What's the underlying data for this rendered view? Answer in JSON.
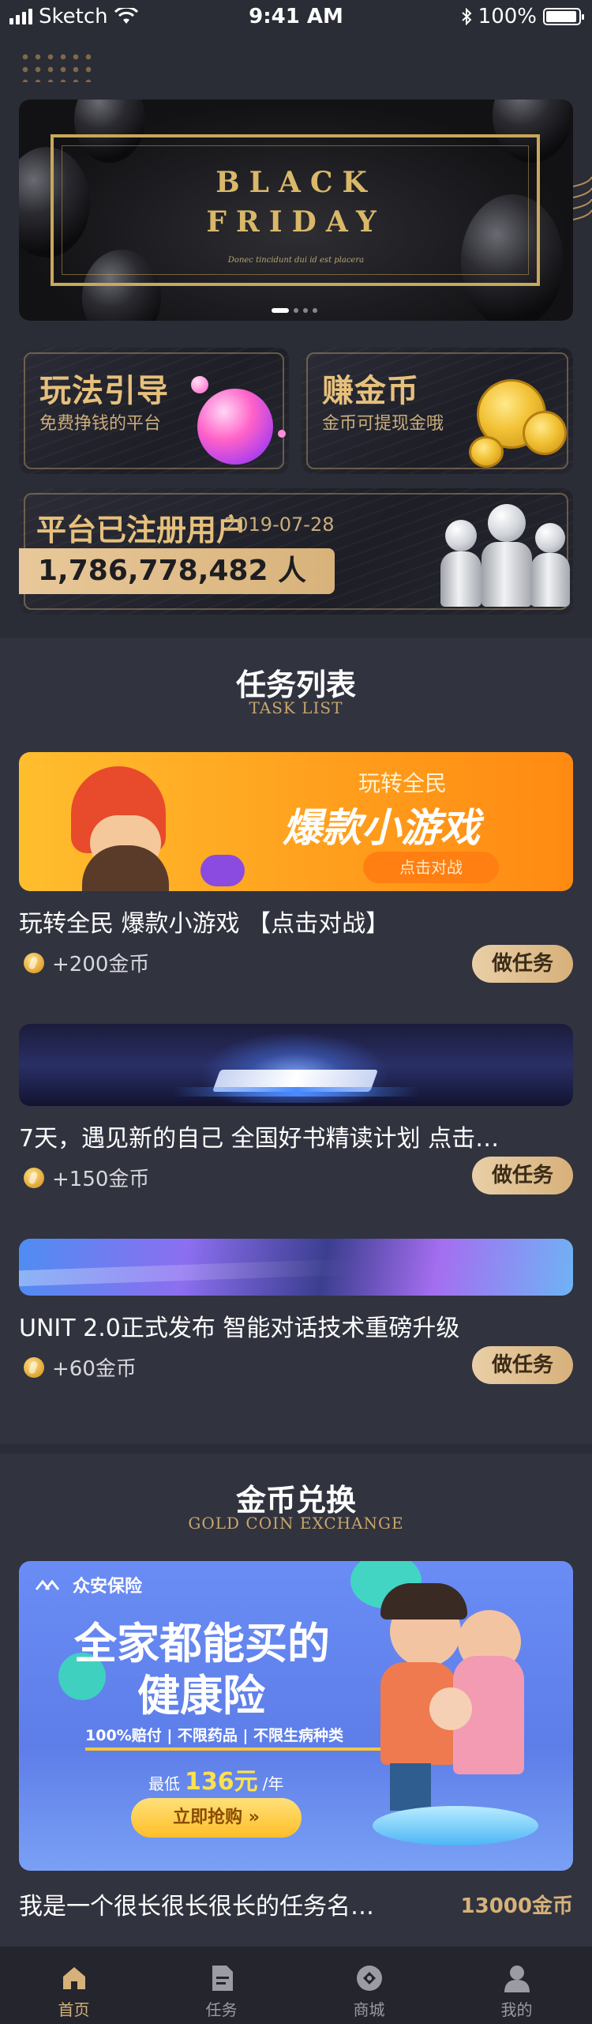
{
  "status_bar": {
    "carrier": "Sketch",
    "time": "9:41 AM",
    "battery": "100%"
  },
  "banner": {
    "line1": "BLACK",
    "line2": "FRIDAY",
    "tagline": "Donec tincidunt dui id est placera",
    "slide_count": 4,
    "active_slide": 1
  },
  "promo_cards": {
    "guide": {
      "title": "玩法引导",
      "desc": "免费挣钱的平台"
    },
    "earn": {
      "title": "赚金币",
      "desc": "金币可提现金哦"
    }
  },
  "registered": {
    "title": "平台已注册用户",
    "date": "2019-07-28",
    "count": "1,786,778,482 人"
  },
  "task_section": {
    "title": "任务列表",
    "subtitle": "TASK LIST"
  },
  "tasks": [
    {
      "banner_text": "玩转全民",
      "banner_big": "爆款小游戏",
      "banner_btn": "点击对战",
      "name": "玩转全民 爆款小游戏 【点击对战】",
      "reward": "+200金币",
      "button": "做任务"
    },
    {
      "name": "7天，遇见新的自己 全国好书精读计划 点击…",
      "reward": "+150金币",
      "button": "做任务"
    },
    {
      "name": "UNIT 2.0正式发布 智能对话技术重磅升级",
      "reward": "+60金币",
      "button": "做任务"
    }
  ],
  "exchange_section": {
    "title": "金币兑换",
    "subtitle": "GOLD COIN EXCHANGE"
  },
  "exchange_item": {
    "brand": "众安保险",
    "headline1": "全家都能买的",
    "headline2": "健康险",
    "features": "100%赔付 | 不限药品 | 不限生病种类",
    "price_prefix": "最低",
    "price": "136元",
    "price_suffix": "/年",
    "cta": "立即抢购 »",
    "name": "我是一个很长很长很长的任务名…",
    "cost": "13000金币"
  },
  "nav": {
    "items": [
      {
        "label": "首页",
        "icon": "home-icon",
        "active": true
      },
      {
        "label": "任务",
        "icon": "task-icon",
        "active": false
      },
      {
        "label": "商城",
        "icon": "mall-icon",
        "active": false
      },
      {
        "label": "我的",
        "icon": "profile-icon",
        "active": false
      }
    ]
  },
  "colors": {
    "background": "#2a2c36",
    "gold": "#d6b27a",
    "section": "#31333f",
    "orange": "#ffa726"
  }
}
